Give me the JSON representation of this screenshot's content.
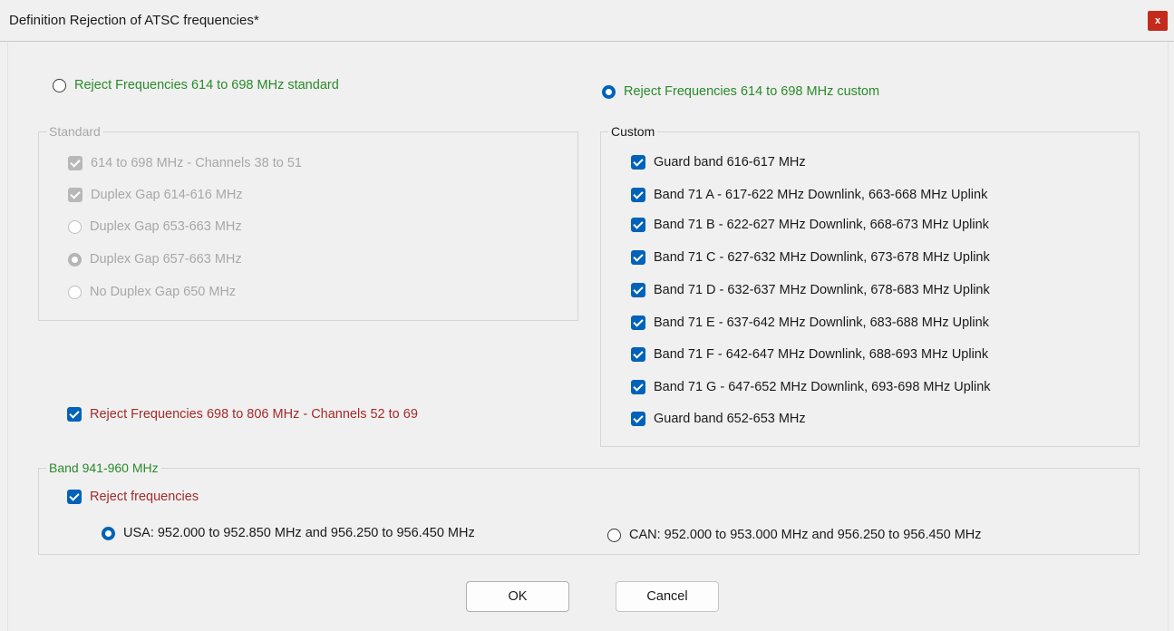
{
  "window": {
    "title": "Definition Rejection of ATSC frequencies*",
    "close_label": "x"
  },
  "standard_option": {
    "label": "Reject Frequencies 614 to 698 MHz standard",
    "selected": false
  },
  "custom_option": {
    "label": "Reject Frequencies 614 to 698 MHz custom",
    "selected": true
  },
  "standard_group": {
    "title": "Standard",
    "items": [
      {
        "type": "checkbox",
        "label": "614 to 698 MHz - Channels 38 to 51",
        "checked": true
      },
      {
        "type": "checkbox",
        "label": "Duplex Gap 614-616 MHz",
        "checked": true
      },
      {
        "type": "radio",
        "label": "Duplex Gap 653-663 MHz",
        "checked": false
      },
      {
        "type": "radio",
        "label": "Duplex Gap 657-663 MHz",
        "checked": true
      },
      {
        "type": "radio",
        "label": "No Duplex Gap 650 MHz",
        "checked": false
      }
    ]
  },
  "custom_group": {
    "title": "Custom",
    "items": [
      {
        "label": "Guard band 616-617 MHz",
        "checked": true
      },
      {
        "label": "Band 71 A - 617-622 MHz Downlink, 663-668 MHz Uplink",
        "checked": true
      },
      {
        "label": "Band 71 B - 622-627 MHz Downlink, 668-673 MHz Uplink",
        "checked": true
      },
      {
        "label": "Band 71 C - 627-632 MHz Downlink, 673-678 MHz Uplink",
        "checked": true
      },
      {
        "label": "Band 71 D - 632-637 MHz Downlink, 678-683 MHz Uplink",
        "checked": true
      },
      {
        "label": "Band 71 E - 637-642 MHz Downlink, 683-688 MHz Uplink",
        "checked": true
      },
      {
        "label": "Band 71 F - 642-647 MHz Downlink, 688-693 MHz Uplink",
        "checked": true
      },
      {
        "label": "Band 71 G - 647-652 MHz Downlink, 693-698 MHz Uplink",
        "checked": true
      },
      {
        "label": "Guard band 652-653 MHz",
        "checked": true
      }
    ]
  },
  "reject_698_806": {
    "label": "Reject Frequencies 698 to 806 MHz - Channels 52 to 69",
    "checked": true
  },
  "band_941_group": {
    "title": "Band 941-960 MHz",
    "reject_label": "Reject frequencies",
    "reject_checked": true,
    "usa_label": "USA: 952.000 to 952.850 MHz and 956.250 to 956.450 MHz",
    "usa_selected": true,
    "can_label": "CAN: 952.000 to 953.000 MHz and 956.250 to 956.450 MHz",
    "can_selected": false
  },
  "buttons": {
    "ok": "OK",
    "cancel": "Cancel"
  },
  "colors": {
    "accent": "#0062b8",
    "green_label": "#2a8a2a",
    "red_label": "#a52a2a",
    "disabled": "#a8a8a8"
  }
}
